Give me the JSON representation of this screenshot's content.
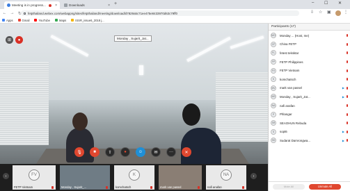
{
  "browser": {
    "tabs": [
      {
        "title": "Meeting is in progress...",
        "active": true,
        "icon": "webex-icon"
      },
      {
        "title": "Downloads",
        "active": false,
        "icon": "downloads-icon"
      }
    ],
    "url": "fetpthailand.webex.com/webappng/sites/fetpthailand/meeting/download/d7829a5c71ee475e8433970d63c79ff0",
    "bookmarks": [
      "Apps",
      "Gmail",
      "YouTube",
      "Maps",
      "ISSR_issue6_2018 j..."
    ]
  },
  "meeting": {
    "active_speaker": "Monday , Sujarit_Jat...",
    "controls": [
      "mute-button",
      "stop-video-button",
      "share-button",
      "record-button",
      "participants-button",
      "chat-button",
      "more-button",
      "leave-button"
    ],
    "thumbnails": [
      {
        "initials": "FV",
        "name": "FETP Vietnam",
        "video": false
      },
      {
        "initials": "",
        "name": "Monday , Sujarit_...",
        "video": true
      },
      {
        "initials": "K",
        "name": "komchatsch",
        "video": false
      },
      {
        "initials": "",
        "name": "mark van passel",
        "video": true
      },
      {
        "initials": "NA",
        "name": "nafi anafan",
        "video": false
      }
    ]
  },
  "participants": {
    "header": "Participants (17)",
    "list": [
      {
        "initials": "MO",
        "name": "Monday  ... (Host, me)"
      },
      {
        "initials": "CF",
        "name": "China FETP"
      },
      {
        "initials": "FL",
        "name": "fetest teksktar"
      },
      {
        "initials": "FP",
        "name": "FETP Philippines"
      },
      {
        "initials": "FV",
        "name": "FETP Vietnam"
      },
      {
        "initials": "K",
        "name": "komchatsch"
      },
      {
        "initials": "MV",
        "name": "mark van passel"
      },
      {
        "initials": "MS",
        "name": "Monday , Sujarit_Jat..."
      },
      {
        "initials": "NA",
        "name": "nafi anafan"
      },
      {
        "initials": "P",
        "name": "Phlangar"
      },
      {
        "initials": "SR",
        "name": "SEAOHUN Rebuda"
      },
      {
        "initials": "S",
        "name": "sopt6"
      },
      {
        "initials": "SD",
        "name": "Sudarat Damrongwa..."
      }
    ],
    "mute_all": "Mute All",
    "unmute_all": "Unmute All"
  }
}
